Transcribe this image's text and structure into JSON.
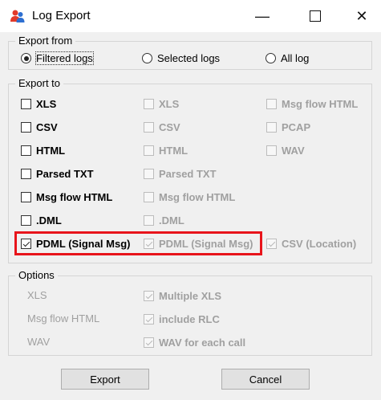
{
  "window": {
    "title": "Log Export",
    "controls": {
      "minimize": "—",
      "close": "✕"
    }
  },
  "export_from": {
    "legend": "Export from",
    "options": [
      {
        "label": "Filtered logs",
        "selected": true
      },
      {
        "label": "Selected logs",
        "selected": false
      },
      {
        "label": "All log",
        "selected": false
      }
    ]
  },
  "export_to": {
    "legend": "Export to",
    "col1": [
      {
        "label": "XLS",
        "checked": false,
        "enabled": true
      },
      {
        "label": "CSV",
        "checked": false,
        "enabled": true
      },
      {
        "label": "HTML",
        "checked": false,
        "enabled": true
      },
      {
        "label": "Parsed TXT",
        "checked": false,
        "enabled": true
      },
      {
        "label": "Msg flow HTML",
        "checked": false,
        "enabled": true
      },
      {
        "label": ".DML",
        "checked": false,
        "enabled": true
      },
      {
        "label": "PDML (Signal Msg)",
        "checked": true,
        "enabled": true
      }
    ],
    "col2": [
      {
        "label": "XLS",
        "checked": false,
        "enabled": false
      },
      {
        "label": "CSV",
        "checked": false,
        "enabled": false
      },
      {
        "label": "HTML",
        "checked": false,
        "enabled": false
      },
      {
        "label": "Parsed TXT",
        "checked": false,
        "enabled": false
      },
      {
        "label": "Msg flow HTML",
        "checked": false,
        "enabled": false
      },
      {
        "label": ".DML",
        "checked": false,
        "enabled": false
      },
      {
        "label": "PDML (Signal Msg)",
        "checked": true,
        "enabled": false
      }
    ],
    "col3": [
      {
        "label": "Msg flow HTML",
        "checked": false,
        "enabled": false
      },
      {
        "label": "PCAP",
        "checked": false,
        "enabled": false
      },
      {
        "label": "WAV",
        "checked": false,
        "enabled": false
      },
      {
        "label": "CSV (Location)",
        "checked": true,
        "enabled": false
      }
    ],
    "highlight_color": "#e8141b"
  },
  "options": {
    "legend": "Options",
    "labels": [
      "XLS",
      "Msg flow HTML",
      "WAV"
    ],
    "checkboxes": [
      {
        "label": "Multiple XLS",
        "checked": true
      },
      {
        "label": "include RLC",
        "checked": true
      },
      {
        "label": "WAV for each call",
        "checked": true
      }
    ]
  },
  "buttons": {
    "export": "Export",
    "cancel": "Cancel"
  }
}
